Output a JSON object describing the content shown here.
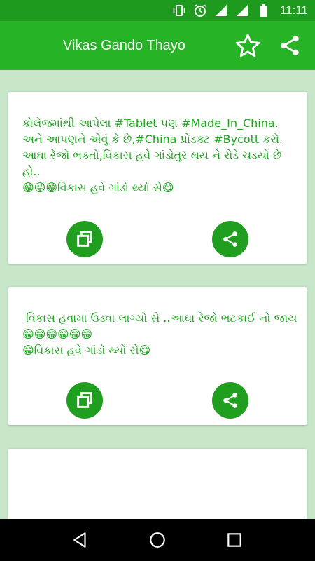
{
  "status_bar": {
    "time": "11:11",
    "icons": [
      "vibrate-icon",
      "alarm-icon",
      "signal-icon",
      "signal-icon",
      "battery-icon"
    ]
  },
  "app_bar": {
    "title": "Vikas Gando Thayo",
    "actions": [
      "star-icon",
      "share-icon"
    ]
  },
  "posts": [
    {
      "text": "કોલેજમાંથી આપેલા #Tablet પણ #Made_In_China.\nઅને આપણને એવું કે છે,#China પ્રોડક્ટ #Bycott કરો.\nઆઘા રેજો ભક્તો,વિકાસ હવે ગાંડોતુર થય ને રોડે ચડયો છે હો..\n😁😜😁વિકાસ હવે ગાંડો થ્યો સે😋",
      "buttons": [
        "copy-icon",
        "share-icon"
      ]
    },
    {
      "text": " વિકાસ હવામાં ઉડવા લાગ્યો સે ..આઘા રેજો ભટકાઈ નો જાય 😁😁😁😁😁😁\n😁વિકાસ હવે ગાંડો થ્યો સે😋",
      "buttons": [
        "copy-icon",
        "share-icon"
      ]
    },
    {
      "text": "",
      "buttons": []
    }
  ],
  "colors": {
    "status_bar": "#1e9a1e",
    "app_bar": "#26b326",
    "background": "#c8e6c9",
    "text": "#1aa51a",
    "fab": "#1f9e1f"
  },
  "nav_bar": [
    "back-icon",
    "home-icon",
    "recents-icon"
  ]
}
